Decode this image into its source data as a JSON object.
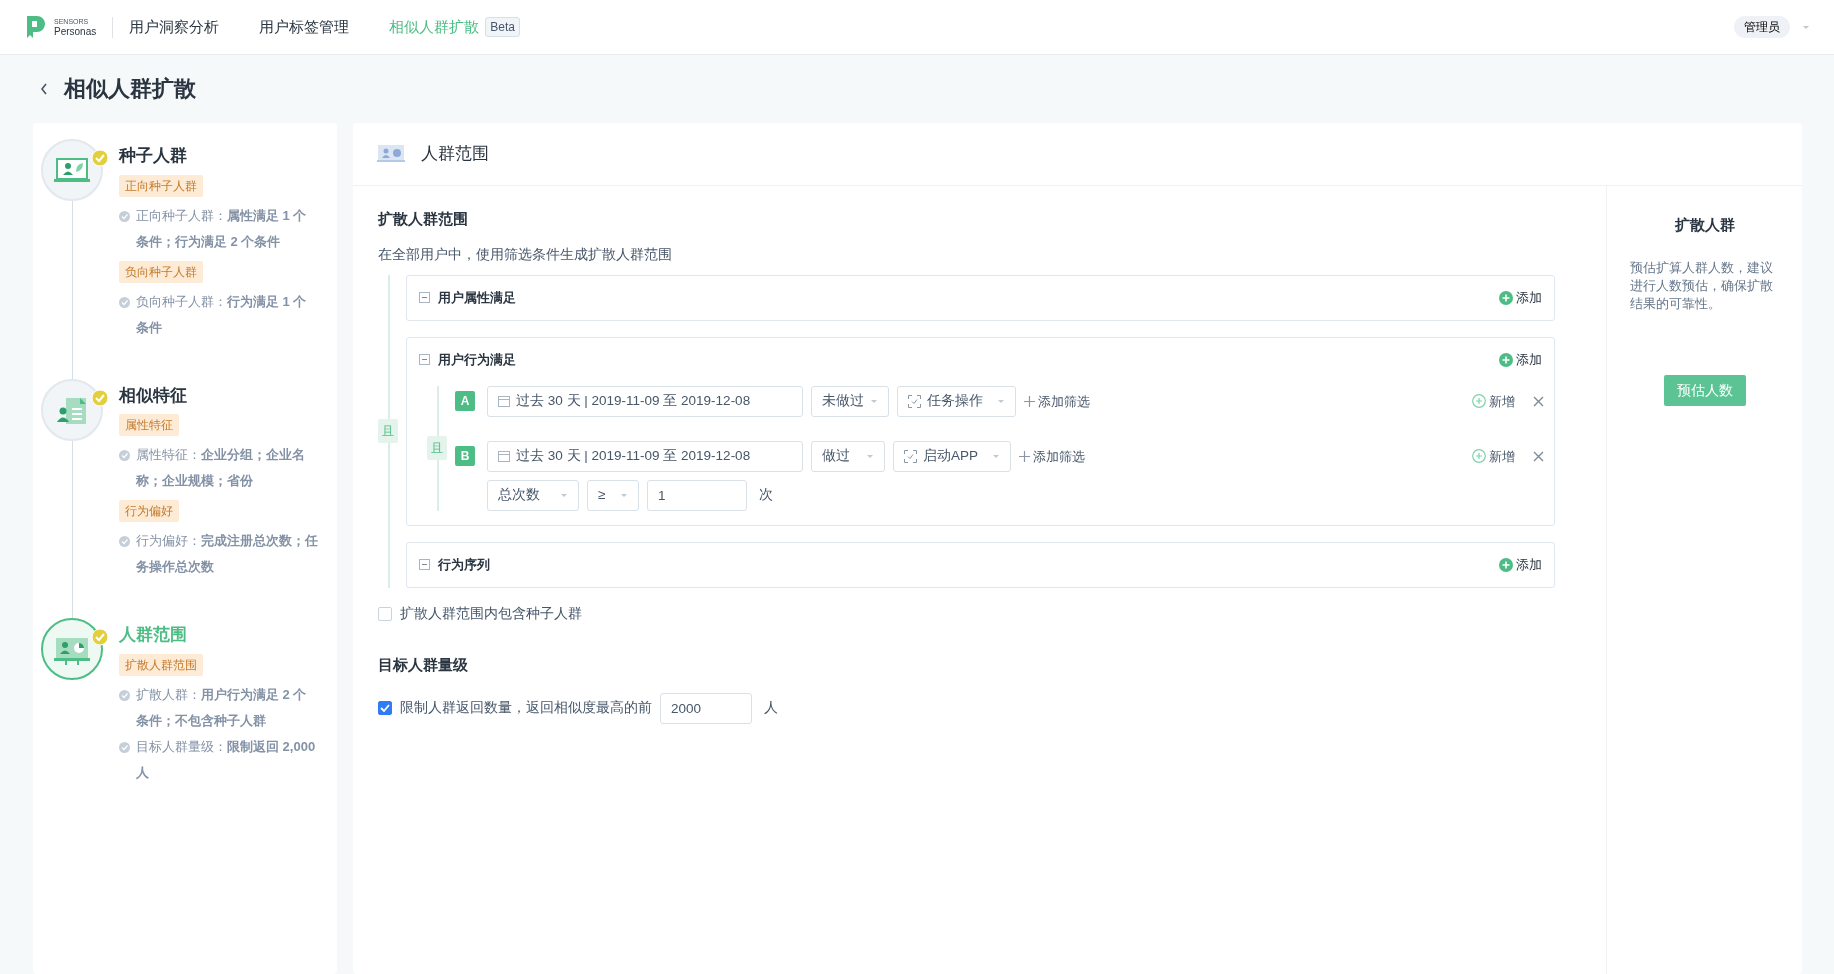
{
  "nav": {
    "brand_small": "SENSORS",
    "brand": "Personas",
    "items": [
      {
        "label": "用户洞察分析",
        "selected": false
      },
      {
        "label": "用户标签管理",
        "selected": false
      },
      {
        "label": "相似人群扩散",
        "selected": true,
        "badge": "Beta"
      }
    ],
    "user": "管理员"
  },
  "page_title": "相似人群扩散",
  "steps": [
    {
      "title": "种子人群",
      "done": true,
      "current": false,
      "sections": [
        {
          "tag": "正向种子人群",
          "details": [
            "正向种子人群：**属性满足 1 个条件；行为满足 2 个条件**"
          ]
        },
        {
          "tag": "负向种子人群",
          "details": [
            "负向种子人群：**行为满足 1 个条件**"
          ]
        }
      ]
    },
    {
      "title": "相似特征",
      "done": true,
      "current": false,
      "sections": [
        {
          "tag": "属性特征",
          "details": [
            "属性特征：**企业分组；企业名称；企业规模；省份**"
          ]
        },
        {
          "tag": "行为偏好",
          "details": [
            "行为偏好：**完成注册总次数；任务操作总次数**"
          ]
        }
      ]
    },
    {
      "title": "人群范围",
      "done": true,
      "current": true,
      "sections": [
        {
          "tag": "扩散人群范围",
          "details": [
            "扩散人群：**用户行为满足 2 个条件；不包含种子人群**",
            "目标人群量级：**限制返回 2,000 人**"
          ]
        }
      ]
    }
  ],
  "panel": {
    "title": "人群范围",
    "section_title": "扩散人群范围",
    "description": "在全部用户中，使用筛选条件生成扩散人群范围",
    "logic": "且",
    "groups": [
      {
        "title": "用户属性满足",
        "expanded": true,
        "add": "添加"
      },
      {
        "title": "用户行为满足",
        "expanded": true,
        "add": "添加",
        "logic": "且",
        "rules": [
          {
            "letter": "A",
            "date_range": "过去 30 天 | 2019-11-09 至 2019-12-08",
            "action": "未做过",
            "event": "任务操作",
            "add_filter": "添加筛选",
            "new": "新增"
          },
          {
            "letter": "B",
            "date_range": "过去 30 天 | 2019-11-09 至 2019-12-08",
            "action": "做过",
            "event": "启动APP",
            "add_filter": "添加筛选",
            "new": "新增",
            "metric": {
              "measure": "总次数",
              "operator": "≥",
              "value": "1",
              "unit": "次"
            }
          }
        ]
      },
      {
        "title": "行为序列",
        "expanded": true,
        "add": "添加"
      }
    ],
    "include_seed": {
      "label": "扩散人群范围内包含种子人群",
      "checked": false
    },
    "target_title": "目标人群量级",
    "limit": {
      "label": "限制人群返回数量，返回相似度最高的前",
      "checked": true,
      "value": "2000",
      "unit": "人"
    }
  },
  "sidebar": {
    "title": "扩散人群",
    "description": "预估扩算人群人数，建议进行人数预估，确保扩散结果的可靠性。",
    "button": "预估人数"
  }
}
